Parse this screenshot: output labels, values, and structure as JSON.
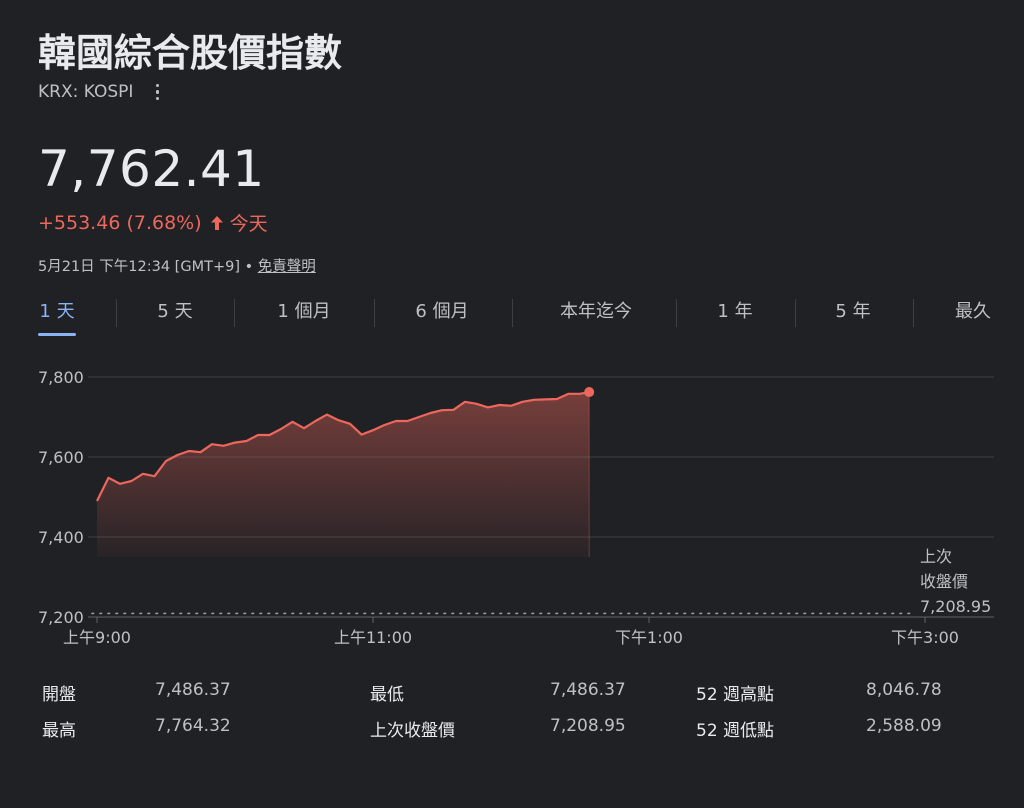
{
  "header": {
    "title": "韓國綜合股價指數",
    "ticker": "KRX: KOSPI",
    "price": "7,762.41",
    "change": "+553.46 (7.68%)",
    "change_period": "今天",
    "timestamp": "5月21日 下午12:34 [GMT+9] •",
    "disclaimer": "免責聲明",
    "up_color": "#ee675c"
  },
  "tabs": [
    {
      "label": "1 天",
      "active": true
    },
    {
      "label": "5 天",
      "active": false
    },
    {
      "label": "1 個月",
      "active": false
    },
    {
      "label": "6 個月",
      "active": false
    },
    {
      "label": "本年迄今",
      "active": false
    },
    {
      "label": "1 年",
      "active": false
    },
    {
      "label": "5 年",
      "active": false
    },
    {
      "label": "最久",
      "active": false
    }
  ],
  "chart_data": {
    "type": "area",
    "x": [
      "09:00",
      "09:05",
      "09:10",
      "09:15",
      "09:20",
      "09:25",
      "09:30",
      "09:35",
      "09:40",
      "09:45",
      "09:50",
      "09:55",
      "10:00",
      "10:05",
      "10:10",
      "10:15",
      "10:20",
      "10:25",
      "10:30",
      "10:35",
      "10:40",
      "10:45",
      "10:50",
      "10:55",
      "11:00",
      "11:05",
      "11:10",
      "11:15",
      "11:20",
      "11:25",
      "11:30",
      "11:35",
      "11:40",
      "11:45",
      "11:50",
      "11:55",
      "12:00",
      "12:05",
      "12:10",
      "12:15",
      "12:20",
      "12:25",
      "12:30",
      "12:34"
    ],
    "values": [
      7490,
      7548,
      7533,
      7540,
      7558,
      7552,
      7590,
      7605,
      7615,
      7612,
      7632,
      7628,
      7636,
      7640,
      7655,
      7655,
      7670,
      7688,
      7672,
      7690,
      7706,
      7692,
      7683,
      7656,
      7667,
      7680,
      7690,
      7690,
      7700,
      7710,
      7717,
      7718,
      7738,
      7733,
      7724,
      7730,
      7728,
      7738,
      7743,
      7744,
      7745,
      7758,
      7758,
      7762.41
    ],
    "x_ticks": [
      "上午9:00",
      "上午11:00",
      "下午1:00",
      "下午3:00"
    ],
    "x_tick_times": [
      "09:00",
      "11:00",
      "13:00",
      "15:00"
    ],
    "x_range": [
      "09:00",
      "15:30"
    ],
    "y_ticks": [
      "7,800",
      "7,600",
      "7,400",
      "7,200"
    ],
    "y_tick_values": [
      7800,
      7600,
      7400,
      7200
    ],
    "ylim": [
      7200,
      7800
    ],
    "previous_close": 7208.95,
    "previous_close_label": [
      "上次",
      "收盤價",
      "7,208.95"
    ],
    "grid": true,
    "line_color": "#ee675c"
  },
  "stats": [
    [
      {
        "label": "開盤",
        "value": "7,486.37"
      },
      {
        "label": "最低",
        "value": "7,486.37"
      },
      {
        "label": "52 週高點",
        "value": "8,046.78"
      }
    ],
    [
      {
        "label": "最高",
        "value": "7,764.32"
      },
      {
        "label": "上次收盤價",
        "value": "7,208.95"
      },
      {
        "label": "52 週低點",
        "value": "2,588.09"
      }
    ]
  ]
}
